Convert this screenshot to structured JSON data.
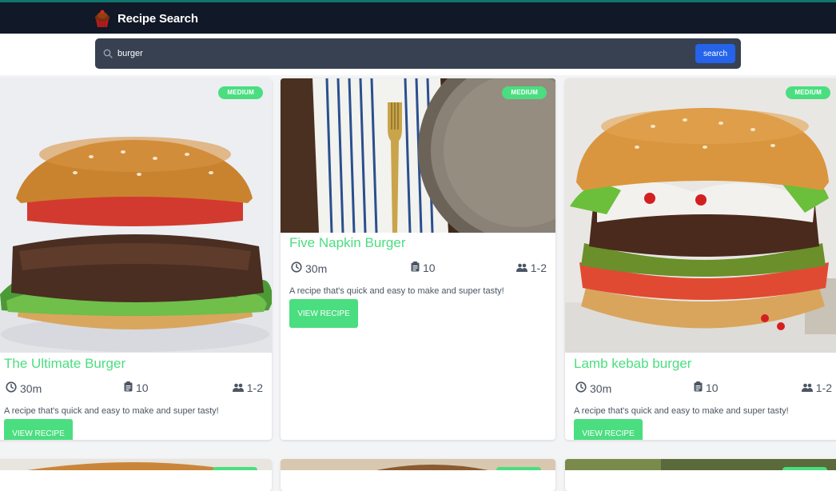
{
  "header": {
    "title": "Recipe Search",
    "logo_icon": "cupcake-icon"
  },
  "search": {
    "value": "burger",
    "placeholder": "",
    "button_label": "search"
  },
  "colors": {
    "accent": "#4ade80",
    "navbar": "#111827",
    "search_bar": "#374151",
    "search_button": "#2563eb",
    "top_line": "#0f766e"
  },
  "recipes": [
    {
      "title": "The Ultimate Burger",
      "difficulty": "MEDIUM",
      "time": "30m",
      "ingredients": "10",
      "servings": "1-2",
      "description": "A recipe that's quick and easy to make and super tasty!",
      "button_label": "VIEW RECIPE"
    },
    {
      "title": "Five Napkin Burger",
      "difficulty": "MEDIUM",
      "time": "30m",
      "ingredients": "10",
      "servings": "1-2",
      "description": "A recipe that's quick and easy to make and super tasty!",
      "button_label": "VIEW RECIPE"
    },
    {
      "title": "Lamb kebab burger",
      "difficulty": "MEDIUM",
      "time": "30m",
      "ingredients": "10",
      "servings": "1-2",
      "description": "A recipe that's quick and easy to make and super tasty!",
      "button_label": "VIEW RECIPE"
    }
  ]
}
